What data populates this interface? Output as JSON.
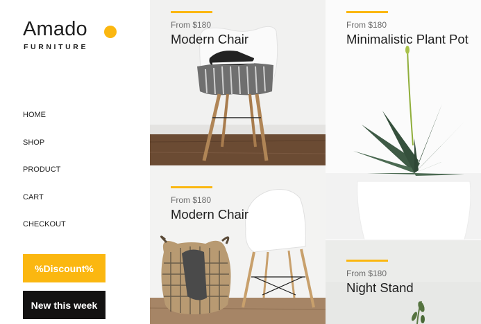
{
  "brand": {
    "name": "Amado",
    "tagline": "FURNITURE"
  },
  "nav": [
    "HOME",
    "SHOP",
    "PRODUCT",
    "CART",
    "CHECKOUT"
  ],
  "buttons": {
    "discount": "%Discount%",
    "new_week": "New this week"
  },
  "products": [
    {
      "price": "From $180",
      "name": "Modern Chair"
    },
    {
      "price": "From $180",
      "name": "Minimalistic Plant Pot"
    },
    {
      "price": "From $180",
      "name": "Modern Chair"
    },
    {
      "price": "From $180",
      "name": "Night Stand"
    }
  ],
  "colors": {
    "accent": "#fbb710",
    "dark": "#131212",
    "text": "#1e1e1e"
  }
}
